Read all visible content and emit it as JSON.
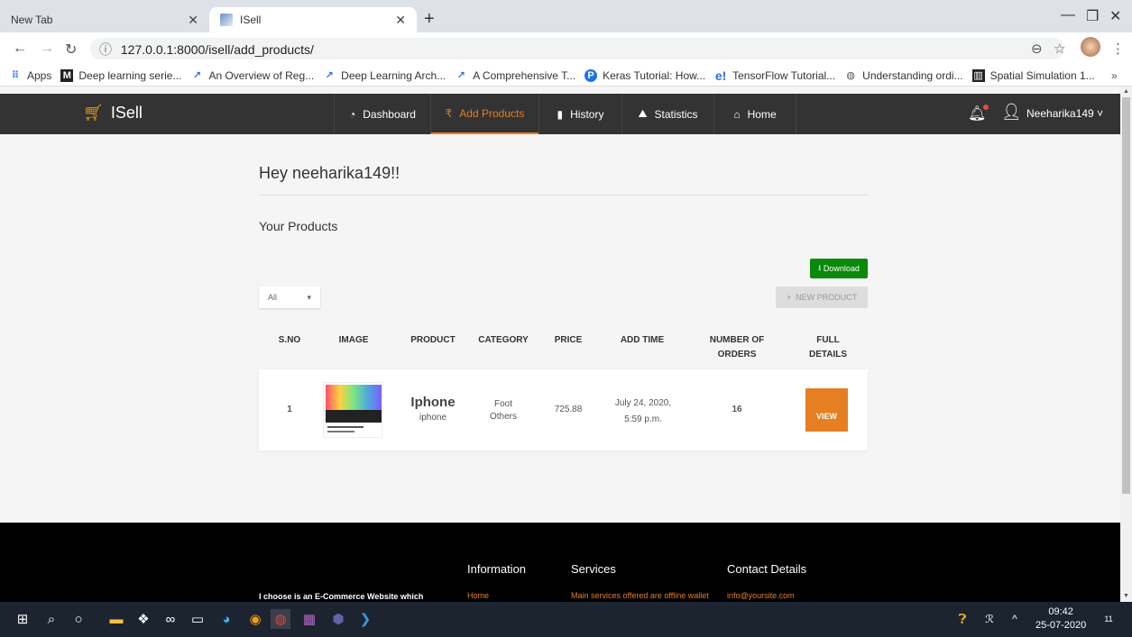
{
  "browser": {
    "tabs": [
      {
        "title": "New Tab"
      },
      {
        "title": "ISell"
      }
    ],
    "url": "127.0.0.1:8000/isell/add_products/",
    "bookmarks": [
      {
        "label": "Apps",
        "icon": "apps-grid-icon"
      },
      {
        "label": "Deep learning serie...",
        "icon": "medium-icon"
      },
      {
        "label": "An Overview of Reg...",
        "icon": "trend-icon"
      },
      {
        "label": "Deep Learning Arch...",
        "icon": "trend-icon"
      },
      {
        "label": "A Comprehensive T...",
        "icon": "trend-icon"
      },
      {
        "label": "Keras Tutorial: How...",
        "icon": "p-icon"
      },
      {
        "label": "TensorFlow Tutorial...",
        "icon": "e-icon"
      },
      {
        "label": "Understanding ordi...",
        "icon": "globe-icon"
      },
      {
        "label": "Spatial Simulation 1...",
        "icon": "chart-icon"
      }
    ]
  },
  "navbar": {
    "brand": "ISell",
    "items": [
      {
        "label": "Dashboard",
        "icon": "dashboard-icon"
      },
      {
        "label": "Add Products",
        "icon": "rupee-icon"
      },
      {
        "label": "History",
        "icon": "book-icon"
      },
      {
        "label": "Statistics",
        "icon": "area-chart-icon"
      },
      {
        "label": "Home",
        "icon": "home-icon"
      }
    ],
    "username": "Neeharika149"
  },
  "main": {
    "greeting": "Hey neeharika149!!",
    "section_title": "Your Products",
    "download_label": "Download",
    "filter_value": "All",
    "new_product_label": "NEW PRODUCT",
    "table": {
      "headers": [
        "S.NO",
        "IMAGE",
        "PRODUCT",
        "CATEGORY",
        "PRICE",
        "ADD TIME",
        "NUMBER OF ORDERS",
        "FULL DETAILS"
      ],
      "headers_display": {
        "sno": "S.NO",
        "image": "IMAGE",
        "product": "PRODUCT",
        "category": "CATEGORY",
        "price": "PRICE",
        "add_time": "ADD TIME",
        "orders_1": "NUMBER OF",
        "orders_2": "ORDERS",
        "details_1": "FULL",
        "details_2": "DETAILS"
      },
      "rows": [
        {
          "sno": "1",
          "product_name": "Iphone",
          "product_sub": "iphone",
          "category_1": "Foot",
          "category_2": "Others",
          "price": "725.88",
          "add_time_1": "July 24, 2020,",
          "add_time_2": "5:59 p.m.",
          "orders": "16",
          "action": "VIEW"
        }
      ]
    }
  },
  "footer": {
    "about": "I choose is an E-Commerce Website which provides platform to buy and",
    "headings": [
      "Information",
      "Services",
      "Contact Details"
    ],
    "links": [
      "Home",
      "Main services offered are offline wallet",
      "info@yoursite.com"
    ]
  },
  "taskbar": {
    "time": "09:42",
    "date": "25-07-2020",
    "notification_count": "11"
  }
}
